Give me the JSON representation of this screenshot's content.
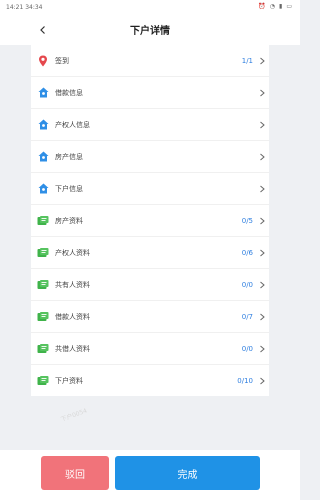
{
  "status_bar": {
    "time": "14:21 34:34"
  },
  "header": {
    "title": "下户详情"
  },
  "rows": [
    {
      "label": "签到",
      "count": "1/1",
      "icon": "location-pin-icon"
    },
    {
      "label": "借款信息",
      "count": "",
      "icon": "house-icon"
    },
    {
      "label": "产权人信息",
      "count": "",
      "icon": "house-icon"
    },
    {
      "label": "房产信息",
      "count": "",
      "icon": "house-icon"
    },
    {
      "label": "下户信息",
      "count": "",
      "icon": "house-icon"
    },
    {
      "label": "房产资料",
      "count": "0/5",
      "icon": "document-icon"
    },
    {
      "label": "产权人资料",
      "count": "0/6",
      "icon": "document-icon"
    },
    {
      "label": "共有人资料",
      "count": "0/0",
      "icon": "document-icon"
    },
    {
      "label": "借款人资料",
      "count": "0/7",
      "icon": "document-icon"
    },
    {
      "label": "共借人资料",
      "count": "0/0",
      "icon": "document-icon"
    },
    {
      "label": "下户资料",
      "count": "0/10",
      "icon": "document-icon"
    }
  ],
  "watermark": "下户0054",
  "footer": {
    "reject_label": "驳回",
    "done_label": "完成"
  },
  "colors": {
    "accent": "#1f92e6",
    "reject": "#f1737a",
    "pin": "#e5484d",
    "house": "#2f8fe6",
    "document": "#3fb34a"
  }
}
